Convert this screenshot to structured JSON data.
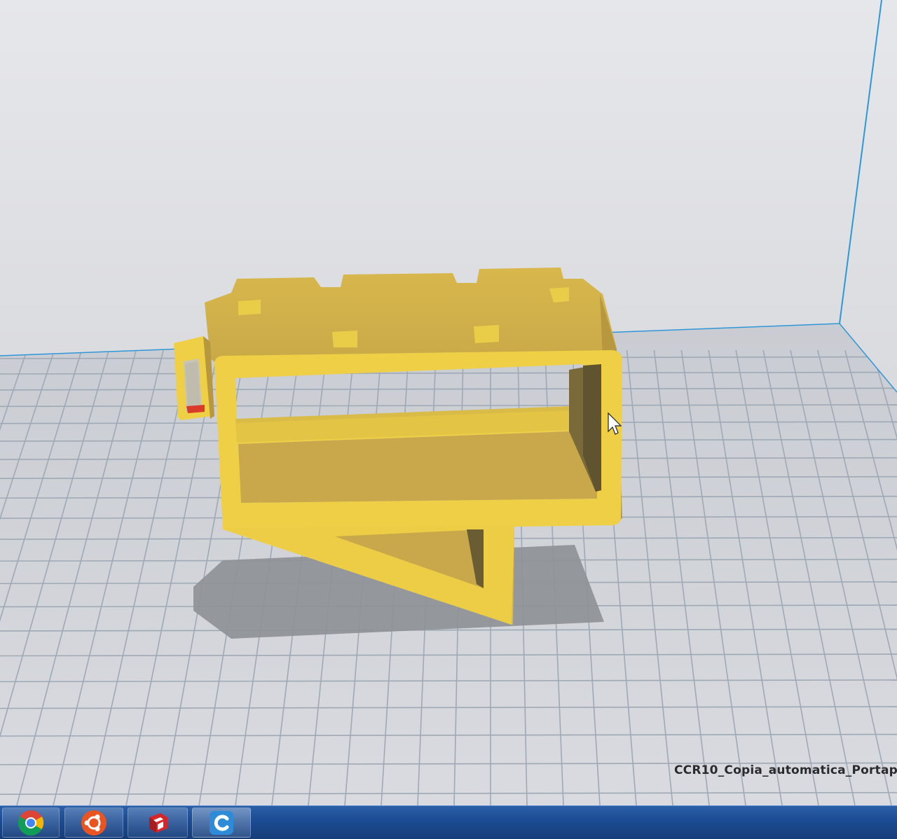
{
  "app": {
    "name": "Cura",
    "model_label": "CCR10_Copia_automatica_Portap"
  },
  "taskbar": {
    "items": [
      {
        "name": "chrome",
        "icon": "chrome-icon"
      },
      {
        "name": "ubuntu",
        "icon": "ubuntu-icon"
      },
      {
        "name": "sketchup",
        "icon": "sketchup-icon"
      },
      {
        "name": "cura",
        "icon": "cura-icon",
        "active": true
      }
    ]
  },
  "colors": {
    "model_light": "#efd046",
    "model_mid": "#d2b041",
    "model_dark": "#c9a94a",
    "model_inner": "#b89a44",
    "grid_line": "#9fa9b6",
    "build_volume_edge": "#2f97d8",
    "shadow": "#8e9297",
    "taskbar": "#1b4b91"
  }
}
